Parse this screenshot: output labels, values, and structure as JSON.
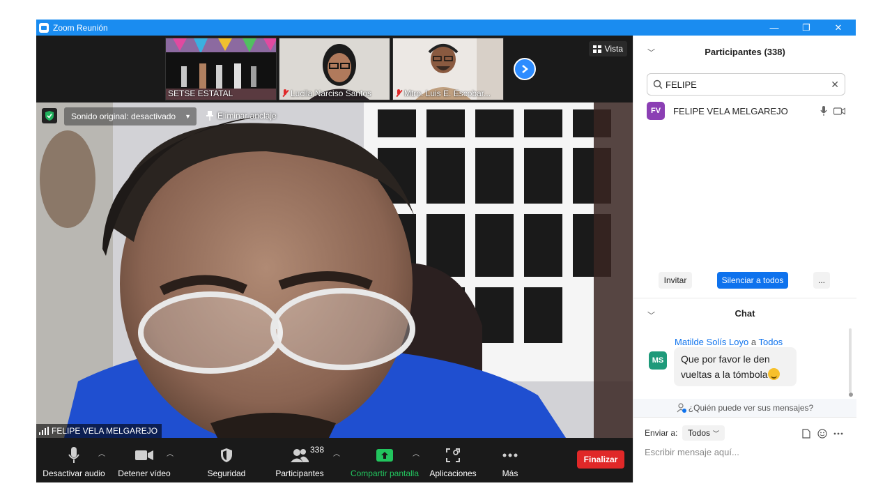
{
  "titlebar": {
    "title": "Zoom Reunión",
    "min": "—",
    "restore": "❐",
    "close": "✕"
  },
  "strip": {
    "thumbs": [
      {
        "name": "SETSE ESTATAL"
      },
      {
        "name": "Lucila Narciso Santos"
      },
      {
        "name": "Mtro. Luis E. Escobar..."
      }
    ],
    "view_label": "Vista"
  },
  "main_video": {
    "audio_label": "Sonido original: desactivado",
    "unpin_label": "Eliminar anclaje",
    "speaker_name": "FELIPE VELA MELGAREJO"
  },
  "toolbar": {
    "mute_label": "Desactivar audio",
    "video_label": "Detener vídeo",
    "security_label": "Seguridad",
    "participants_label": "Participantes",
    "participants_count": "338",
    "share_label": "Compartir pantalla",
    "apps_label": "Aplicaciones",
    "more_label": "Más",
    "end_label": "Finalizar"
  },
  "participants": {
    "title": "Participantes (338)",
    "search_value": "FELIPE",
    "list": [
      {
        "initials": "FV",
        "name": "FELIPE VELA MELGAREJO",
        "avatar_color": "#8b3fb4"
      }
    ],
    "invite_label": "Invitar",
    "mute_all_label": "Silenciar a todos",
    "more_label": "..."
  },
  "chat": {
    "title": "Chat",
    "messages": [
      {
        "initials": "MS",
        "sender": "Matilde Solís Loyo",
        "to_word": "a",
        "recipient": "Todos",
        "text": "Que por favor le den vueltas a la tómbola",
        "avatar_color": "#1e9a7a"
      }
    ],
    "who_can_see": "¿Quién puede ver sus mensajes?",
    "send_to_label": "Enviar a:",
    "send_to_value": "Todos",
    "input_placeholder": "Escribir mensaje aquí..."
  },
  "colors": {
    "accent": "#2d8cff",
    "titlebar": "#1a8cf0",
    "danger": "#e02828",
    "share_green": "#22c55e"
  }
}
